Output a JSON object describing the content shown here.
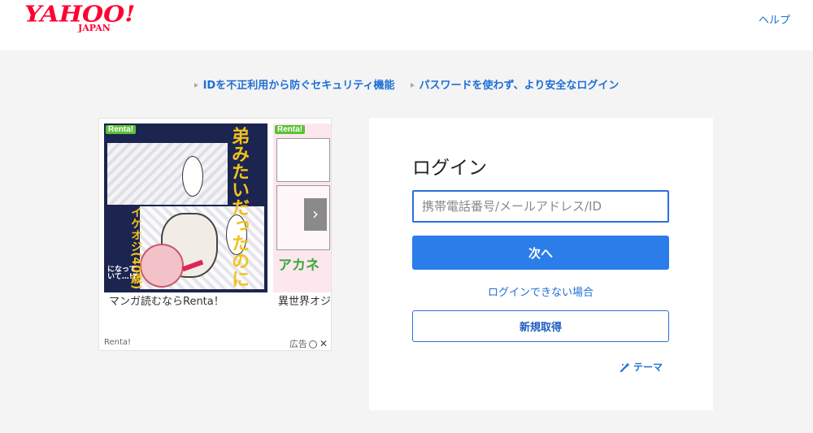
{
  "header": {
    "logo": {
      "text": "YAHOO!",
      "sub": "JAPAN",
      "color": "#ff0033"
    },
    "help_label": "ヘルプ"
  },
  "info_links": [
    {
      "label": "IDを不正利用から防ぐセキュリティ機能"
    },
    {
      "label": "パスワードを使わず、より安全なログイン"
    }
  ],
  "ad": {
    "cards": [
      {
        "badge": "Renta!",
        "art_text_top": "弟みたいだったのに",
        "art_text_yellow": "イケオジ(40歳)",
        "art_text_bottom": "になっていて…!?",
        "title": "マンガ読むならRenta！"
      },
      {
        "badge": "Renta!",
        "art_text_green": "アカネ",
        "title": "異世界オジ"
      }
    ],
    "next_arrow": "›",
    "sponsor": "Renta!",
    "choice_label": "広告",
    "close_glyph": "✕"
  },
  "login": {
    "title": "ログイン",
    "id_input": {
      "value": "",
      "placeholder": "携帯電話番号/メールアドレス/ID"
    },
    "next_label": "次へ",
    "trouble_label": "ログインできない場合",
    "signup_label": "新規取得",
    "theme_label": "テーマ",
    "accent_color": "#2b7de9"
  }
}
